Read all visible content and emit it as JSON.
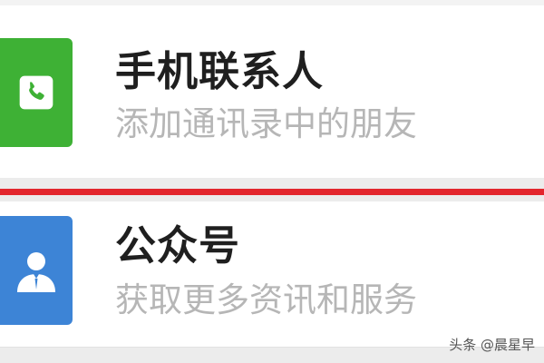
{
  "items": [
    {
      "title": "手机联系人",
      "subtitle": "添加通讯录中的朋友",
      "icon": "phone-icon",
      "tile_color": "#3eb135"
    },
    {
      "title": "公众号",
      "subtitle": "获取更多资讯和服务",
      "icon": "official-account-icon",
      "tile_color": "#3d84d6"
    }
  ],
  "divider_color": "#e3262d",
  "watermark": "头条 @晨星早"
}
